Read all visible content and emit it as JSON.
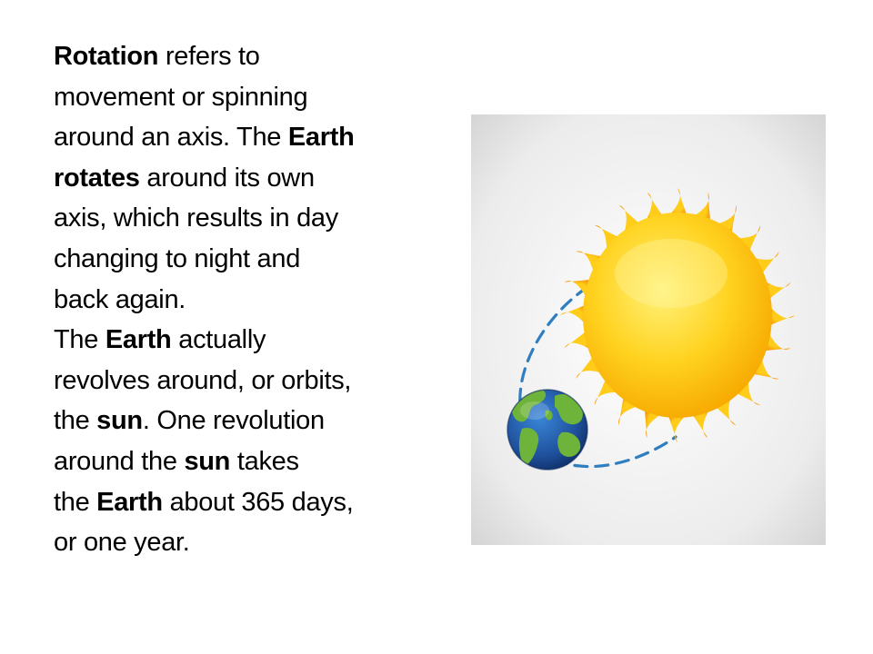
{
  "slide": {
    "paragraphs": [
      {
        "lines": [
          [
            {
              "t": "Rotation",
              "b": true
            },
            {
              "t": " refers to",
              "b": false
            }
          ],
          [
            {
              "t": "movement or spinning",
              "b": false
            }
          ],
          [
            {
              "t": "around an axis. The ",
              "b": false
            },
            {
              "t": "Earth",
              "b": true
            }
          ],
          [
            {
              "t": "rotates",
              "b": true
            },
            {
              "t": " around its own",
              "b": false
            }
          ],
          [
            {
              "t": "axis, which results in day",
              "b": false
            }
          ],
          [
            {
              "t": "changing to night and",
              "b": false
            }
          ],
          [
            {
              "t": "back again.",
              "b": false
            }
          ]
        ]
      },
      {
        "lines": [
          [
            {
              "t": "The ",
              "b": false
            },
            {
              "t": "Earth",
              "b": true
            },
            {
              "t": " actually",
              "b": false
            }
          ],
          [
            {
              "t": "revolves around, or orbits,",
              "b": false
            }
          ],
          [
            {
              "t": "the ",
              "b": false
            },
            {
              "t": "sun",
              "b": true
            },
            {
              "t": ". One revolution",
              "b": false
            }
          ],
          [
            {
              "t": "around the ",
              "b": false
            },
            {
              "t": "sun",
              "b": true
            },
            {
              "t": " takes",
              "b": false
            }
          ],
          [
            {
              "t": "the ",
              "b": false
            },
            {
              "t": "Earth",
              "b": true
            },
            {
              "t": " about 365 days,",
              "b": false
            }
          ],
          [
            {
              "t": "or one year.",
              "b": false
            }
          ]
        ]
      }
    ]
  },
  "illustration": {
    "icons": [
      "sun-icon",
      "earth-icon",
      "orbit-path"
    ],
    "colors": {
      "sun_core": "#ffd21f",
      "sun_rays": "#ffbf12",
      "earth_ocean": "#1e4f9a",
      "earth_land": "#6fb43a",
      "orbit": "#2f7ec0",
      "background": "#dcdcdc"
    }
  }
}
